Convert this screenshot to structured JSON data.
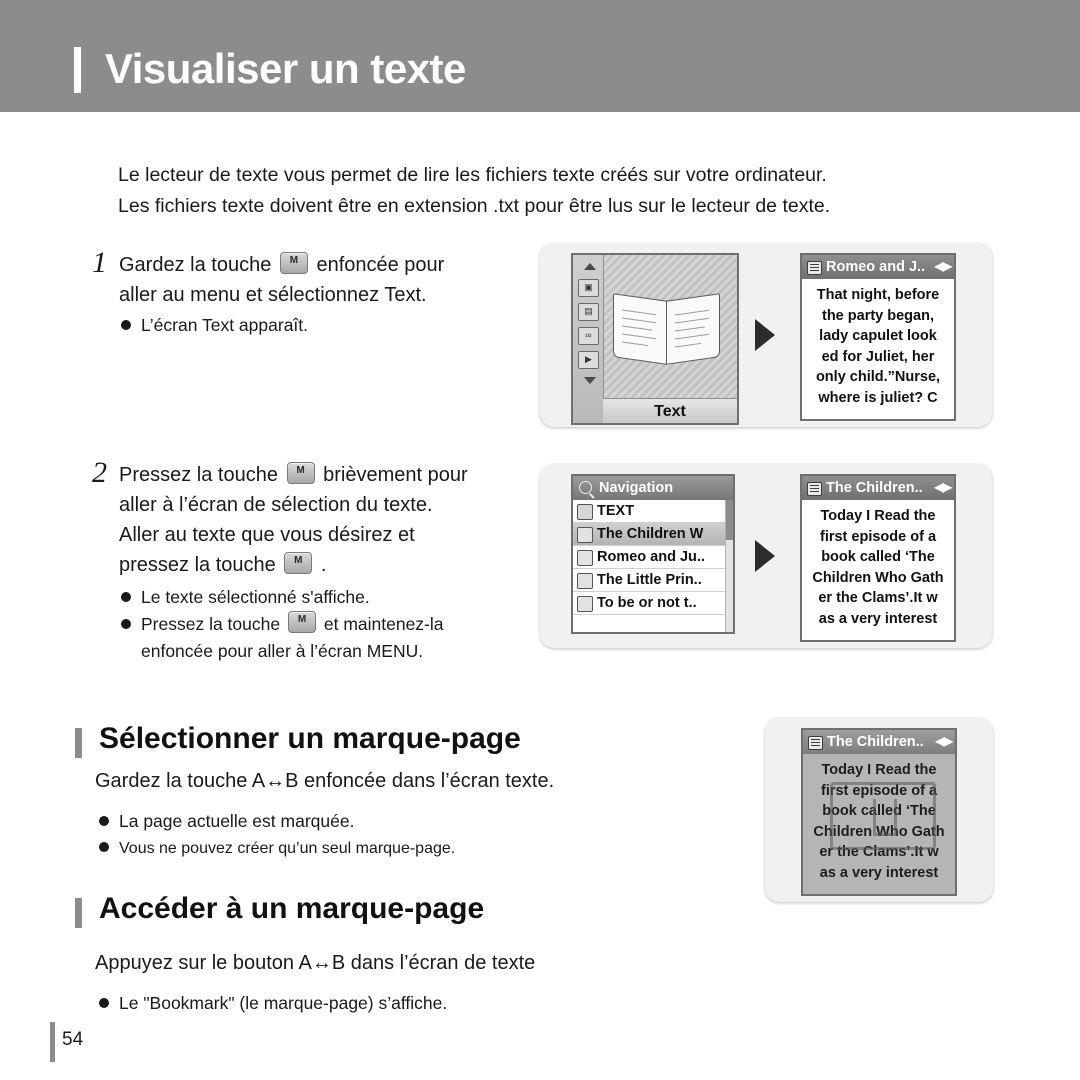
{
  "header": {
    "title": "Visualiser un texte"
  },
  "intro": {
    "line1": "Le lecteur de texte vous permet de lire les fichiers texte créés sur votre ordinateur.",
    "line2": "Les fichiers texte doivent être en extension .txt pour être lus sur le lecteur de texte."
  },
  "steps": [
    {
      "number": "1",
      "text_before_button": "Gardez la touche",
      "button_label": "M",
      "text_after_button": "enfoncée pour",
      "line2": "aller au menu et sélectionnez Text.",
      "bullets": [
        "L’écran Text apparaît."
      ]
    },
    {
      "number": "2",
      "text_before_button": "Pressez la touche",
      "button_label": "M",
      "text_after_button": "brièvement pour",
      "line2": "aller à l’écran de sélection du texte.",
      "line3": "Aller au texte que vous désirez et",
      "line4_before_button": "pressez la touche",
      "line4_after_button": ".",
      "bullets": [
        "Le texte sélectionné s'affiche.",
        "Pressez la touche",
        "et maintenez-la",
        "enfoncée pour aller à l’écran MENU."
      ]
    }
  ],
  "screens": {
    "menu": {
      "label": "Text",
      "side_icons": [
        "up-arrow-icon",
        "photo-icon",
        "text-icon",
        "movie-icon",
        "video-icon",
        "down-arrow-icon"
      ]
    },
    "text_viewer": {
      "title": "Romeo and J..",
      "lines": [
        "That night, before",
        "the party began,",
        "lady capulet look",
        "ed for Juliet, her",
        "only child.”Nurse,",
        "where is juliet? C"
      ]
    },
    "navigation": {
      "title": "Navigation",
      "items": [
        {
          "label": "TEXT",
          "selected": false,
          "icon": "folder-icon"
        },
        {
          "label": "The Children W",
          "selected": true,
          "icon": "text-file-icon"
        },
        {
          "label": "Romeo and Ju..",
          "selected": false,
          "icon": "text-file-icon"
        },
        {
          "label": "The Little Prin..",
          "selected": false,
          "icon": "text-file-icon"
        },
        {
          "label": "To be or not t..",
          "selected": false,
          "icon": "text-file-icon"
        }
      ]
    },
    "children_viewer": {
      "title": "The Children..",
      "lines": [
        "Today I Read the",
        "first episode of a",
        "book called ‘The",
        "Children Who Gath",
        "er the Clams’.It w",
        "as a very interest"
      ]
    },
    "bookmark_viewer": {
      "title": "The Children..",
      "lines": [
        "Today I Read the",
        "first episode of a",
        "book called ‘The",
        "Children Who Gath",
        "er the Clams’.It w",
        "as a very interest"
      ],
      "stamp": "bookmark-stamp-icon"
    }
  },
  "section_bookmark_select": {
    "title": "Sélectionner un marque-page",
    "subtitle": "Gardez la touche A↔B enfoncée dans l’écran texte.",
    "bullets": [
      "La page actuelle est marquée.",
      "Vous ne pouvez créer qu’un seul marque-page."
    ]
  },
  "section_bookmark_access": {
    "title": "Accéder à un marque-page",
    "subtitle": "Appuyez sur le bouton A↔B dans l’écran de texte",
    "bullets": [
      "Le \"Bookmark\" (le marque-page) s’affiche."
    ]
  },
  "footer": {
    "page_number": "54"
  },
  "colors": {
    "header_bg": "#8c8c8c",
    "panel_bg": "#f1f1f1",
    "screen_border": "#6f6f6f",
    "titlebar": "#7d7d7d"
  }
}
